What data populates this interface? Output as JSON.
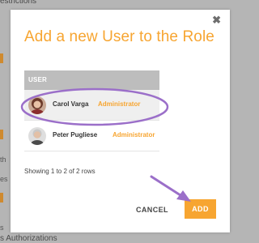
{
  "background": {
    "top_text": "estrictions",
    "bottom_text": "s Authorizations",
    "side_fragments": [
      "th",
      "es",
      "s"
    ],
    "accent_color": "#cf8a2f"
  },
  "modal": {
    "title": "Add a new User to the Role",
    "close_glyph": "✖",
    "accent_color": "#f7a531",
    "table": {
      "column_header": "USER",
      "rows": [
        {
          "name": "Carol Varga",
          "role": "Administrator",
          "avatar": "woman-avatar"
        },
        {
          "name": "Peter Pugliese",
          "role": "Administrator",
          "avatar": "man-avatar"
        }
      ]
    },
    "rows_info": "Showing 1 to 2 of 2 rows",
    "cancel_label": "CANCEL",
    "add_label": "ADD"
  },
  "annotations": {
    "color": "#9b6fc9"
  }
}
